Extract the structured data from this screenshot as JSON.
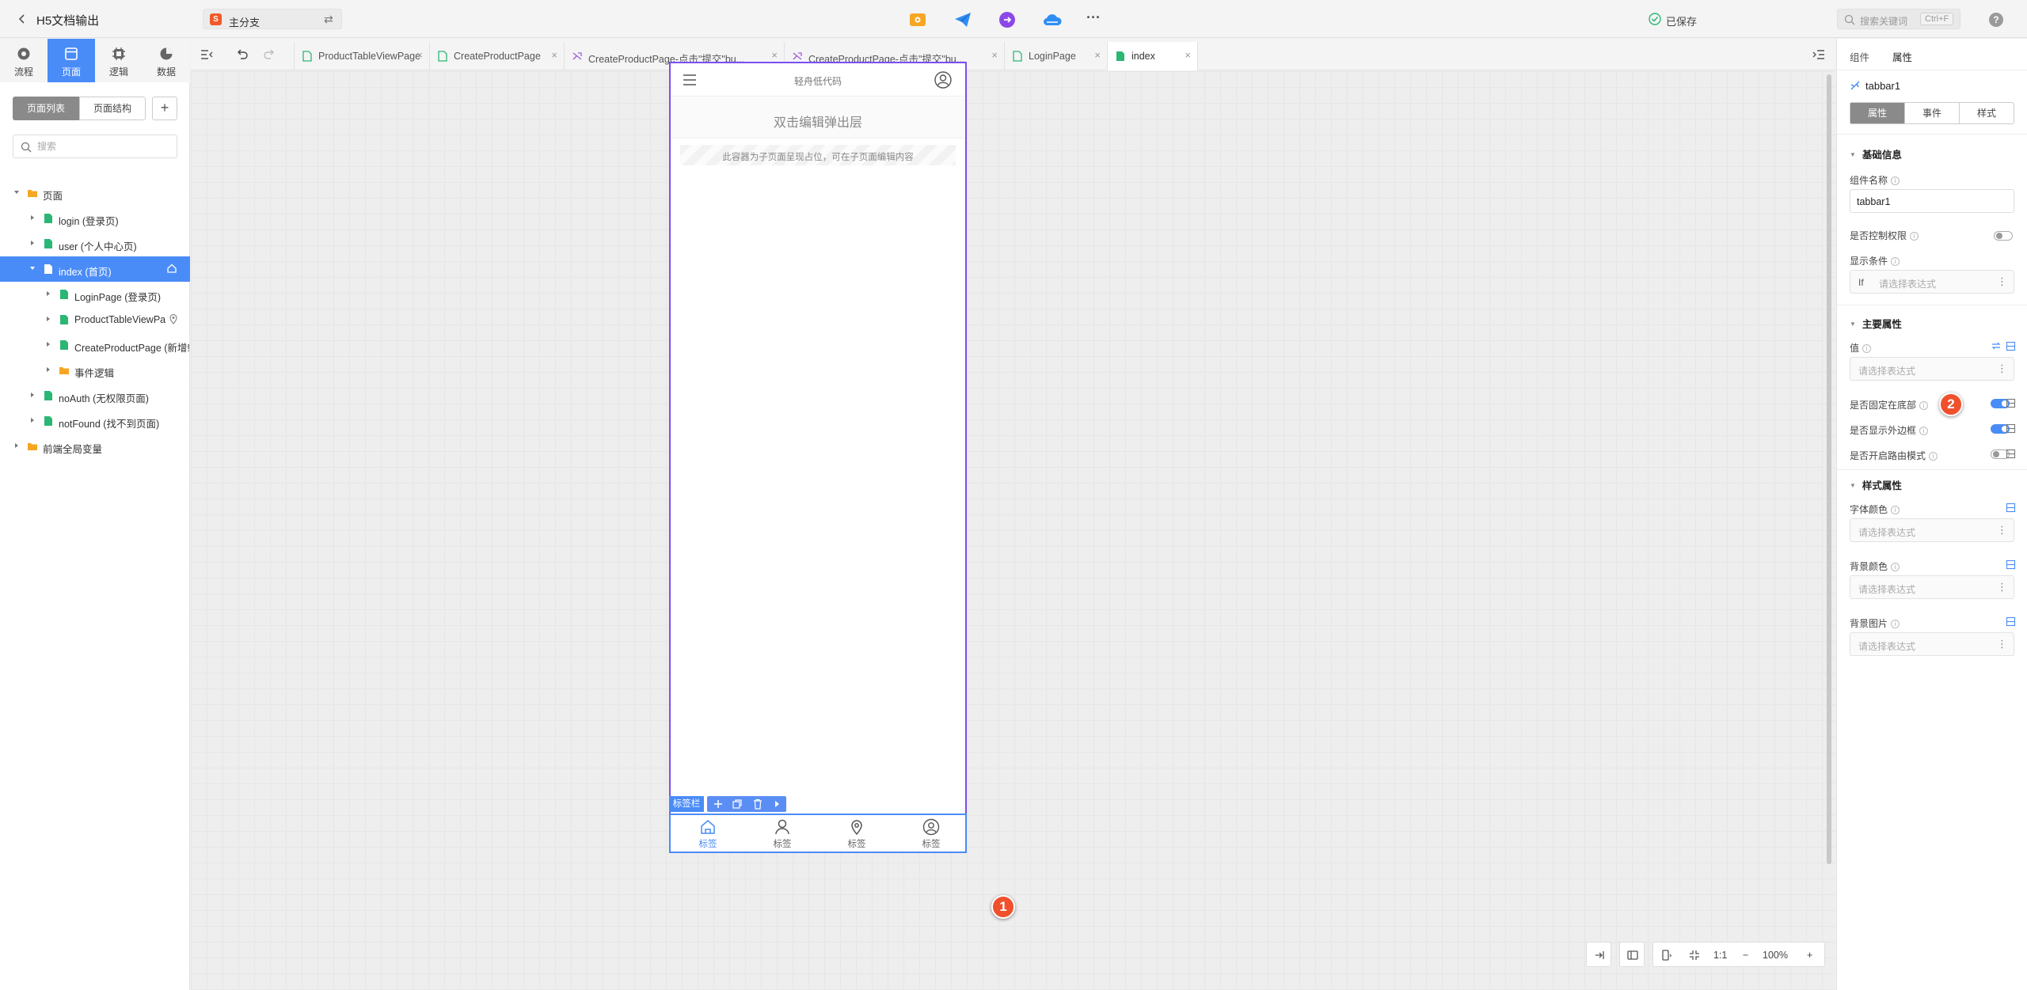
{
  "topbar": {
    "app_title": "H5文档输出",
    "branch": {
      "label": "主分支",
      "swap_glyph": "⇄",
      "icon_text": "S"
    },
    "toolbar_icons": [
      "preview-icon",
      "publish-icon",
      "export-icon",
      "cloud-icon",
      "more-icon"
    ],
    "more_glyph": "···",
    "saved_label": "已保存",
    "search": {
      "placeholder": "搜索关键词",
      "shortcut": "Ctrl+F"
    },
    "help_glyph": "?"
  },
  "left_nav": {
    "items": [
      {
        "label": "流程",
        "icon": "flow-icon"
      },
      {
        "label": "页面",
        "icon": "page-icon",
        "active": true
      },
      {
        "label": "逻辑",
        "icon": "logic-icon"
      },
      {
        "label": "数据",
        "icon": "data-icon"
      }
    ]
  },
  "left_panel": {
    "seg_page_list": "页面列表",
    "seg_page_structure": "页面结构",
    "add_glyph": "+",
    "search_placeholder": "搜索",
    "tree": [
      {
        "label": "页面",
        "type": "folder",
        "depth": 0,
        "expanded": true
      },
      {
        "label": "login (登录页)",
        "type": "page",
        "depth": 1
      },
      {
        "label": "user (个人中心页)",
        "type": "page",
        "depth": 1
      },
      {
        "label": "index (首页)",
        "type": "page",
        "depth": 1,
        "expanded": true,
        "selected": true,
        "trail": "home-icon"
      },
      {
        "label": "LoginPage (登录页)",
        "type": "page",
        "depth": 2
      },
      {
        "label": "ProductTableViewPa",
        "type": "page",
        "depth": 2,
        "trail": "location-icon"
      },
      {
        "label": "CreateProductPage (新增!",
        "type": "page",
        "depth": 2
      },
      {
        "label": "事件逻辑",
        "type": "folder",
        "depth": 2
      },
      {
        "label": "noAuth (无权限页面)",
        "type": "page",
        "depth": 1
      },
      {
        "label": "notFound (找不到页面)",
        "type": "page",
        "depth": 1
      },
      {
        "label": "前端全局变量",
        "type": "folder",
        "depth": 0
      }
    ]
  },
  "tabs": {
    "close_glyph": "×",
    "items": [
      {
        "label": "ProductTableViewPage",
        "icon": "page-icon"
      },
      {
        "label": "CreateProductPage",
        "icon": "page-icon"
      },
      {
        "label": "CreateProductPage-点击\"提交\"bu...",
        "icon": "logic-icon"
      },
      {
        "label": "CreateProductPage-点击\"提交\"bu...",
        "icon": "logic-icon"
      },
      {
        "label": "LoginPage",
        "icon": "page-icon"
      },
      {
        "label": "index",
        "icon": "page-icon",
        "active": true
      }
    ]
  },
  "phone": {
    "title": "轻舟低代码",
    "popup_layer_label": "双击编辑弹出层",
    "subpage_placeholder": "此容器为子页面呈现占位，可在子页面编辑内容",
    "tabbar_chip": "标签栏",
    "tabbar_items": [
      {
        "label": "标签",
        "icon": "home-icon",
        "active": true
      },
      {
        "label": "标签",
        "icon": "user-icon"
      },
      {
        "label": "标签",
        "icon": "location-icon"
      },
      {
        "label": "标签",
        "icon": "user-circle-icon"
      }
    ]
  },
  "badges": {
    "one": "1",
    "two": "2"
  },
  "zoom": {
    "ratio_label": "1:1",
    "percent": "100%",
    "minus": "−",
    "plus": "+"
  },
  "right_panel": {
    "tabs": [
      "组件",
      "属性"
    ],
    "component_name": "tabbar1",
    "segments": [
      "属性",
      "事件",
      "样式"
    ],
    "basic_section": "基础信息",
    "component_name_label": "组件名称",
    "component_name_value": "tabbar1",
    "permission_label": "是否控制权限",
    "permission_on": false,
    "display_condition_label": "显示条件",
    "display_condition_prefix": "If",
    "expr_placeholder": "请选择表达式",
    "main_section": "主要属性",
    "value_label": "值",
    "fixed_bottom_label": "是否固定在底部",
    "fixed_bottom_on": true,
    "show_border_label": "是否显示外边框",
    "show_border_on": true,
    "route_mode_label": "是否开启路由模式",
    "route_mode_on": false,
    "style_section": "样式属性",
    "font_color_label": "字体颜色",
    "bg_color_label": "背景颜色",
    "bg_image_label": "背景图片"
  },
  "colors": {
    "accent": "#4a8cf7",
    "phone_border": "#7b4ff0",
    "badge": "#f0512c",
    "page_icon": "#2bb673",
    "folder_icon": "#f5a623"
  }
}
